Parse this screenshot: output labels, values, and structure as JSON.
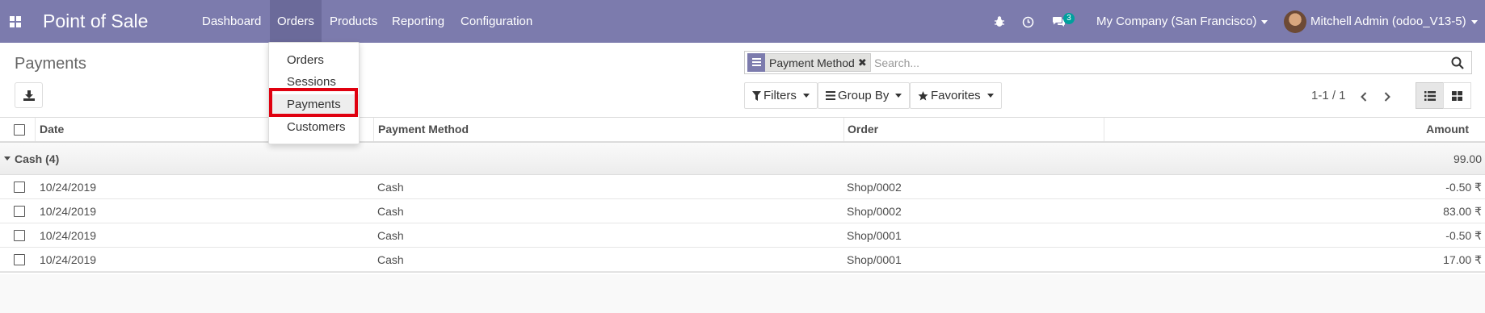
{
  "navbar": {
    "brand": "Point of Sale",
    "menu": [
      "Dashboard",
      "Orders",
      "Products",
      "Reporting",
      "Configuration"
    ],
    "active_menu": "Orders",
    "message_count": "3",
    "company": "My Company (San Francisco)",
    "user": "Mitchell Admin (odoo_V13-5)",
    "bg_color": "#7c7bad"
  },
  "orders_dropdown": {
    "items": [
      "Orders",
      "Sessions",
      "Payments",
      "Customers"
    ],
    "active": "Payments"
  },
  "control_panel": {
    "title": "Payments",
    "search": {
      "facet_label": "Payment Method",
      "placeholder": "Search..."
    },
    "filters_label": "Filters",
    "groupby_label": "Group By",
    "favorites_label": "Favorites",
    "pager": "1-1 / 1"
  },
  "list": {
    "columns": [
      "Date",
      "Payment Method",
      "Order",
      "Amount"
    ],
    "group": {
      "label": "Cash (4)",
      "total": "99.00"
    },
    "rows": [
      {
        "date": "10/24/2019",
        "method": "Cash",
        "order": "Shop/0002",
        "amount": "-0.50 ₹"
      },
      {
        "date": "10/24/2019",
        "method": "Cash",
        "order": "Shop/0002",
        "amount": "83.00 ₹"
      },
      {
        "date": "10/24/2019",
        "method": "Cash",
        "order": "Shop/0001",
        "amount": "-0.50 ₹"
      },
      {
        "date": "10/24/2019",
        "method": "Cash",
        "order": "Shop/0001",
        "amount": "17.00 ₹"
      }
    ]
  }
}
